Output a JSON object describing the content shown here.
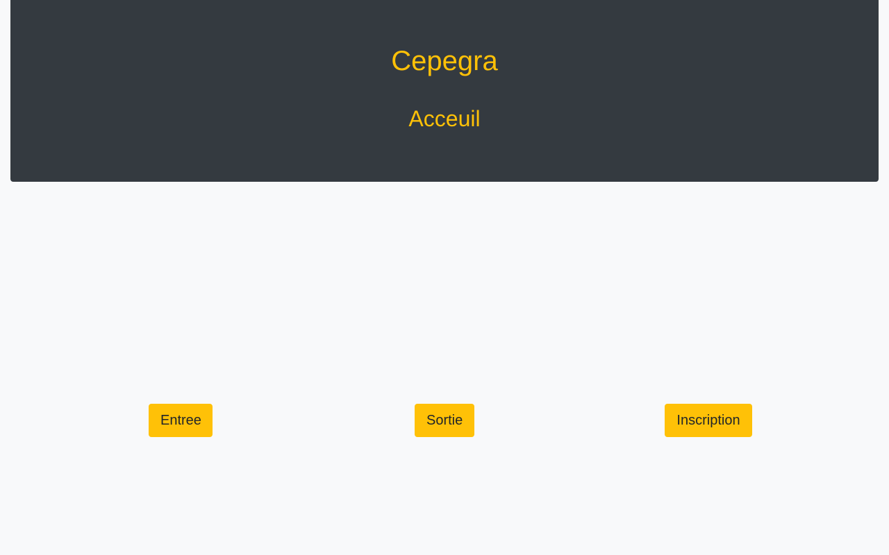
{
  "header": {
    "title": "Cepegra",
    "subtitle": "Acceuil"
  },
  "actions": {
    "entree_label": "Entree",
    "sortie_label": "Sortie",
    "inscription_label": "Inscription"
  },
  "colors": {
    "header_background": "#343a40",
    "accent": "#ffc107",
    "page_background": "#f8f9fa",
    "button_text": "#212529"
  }
}
